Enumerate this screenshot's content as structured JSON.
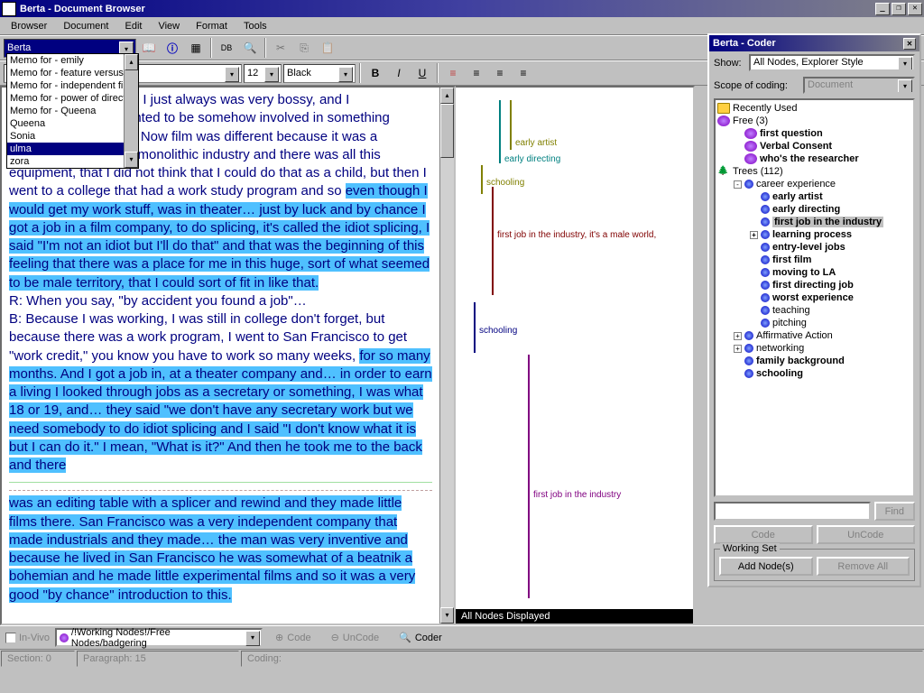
{
  "window": {
    "title": "Berta - Document Browser",
    "min": "_",
    "max": "❐",
    "close": "✕"
  },
  "menu": [
    "Browser",
    "Document",
    "Edit",
    "View",
    "Format",
    "Tools"
  ],
  "toolbar1": {
    "doc_combo": "Berta"
  },
  "dropdown": {
    "items": [
      "Memo for - emily",
      "Memo for - feature versus te",
      "Memo for - independent film",
      "Memo for - power of director",
      "Memo for - Queena",
      "Queena",
      "Sonia",
      "ulma",
      "zora"
    ],
    "selected_index": 7
  },
  "toolbar2": {
    "font": "",
    "size": "12",
    "color": "Black"
  },
  "doc_text": {
    "p1a": "w, I just always was very bossy, and I",
    "p1b": "anted to be somehow involved in something",
    "p1c": "c.  Now film was different because it was a",
    "p1d": "a monolithic industry and there was all this",
    "p1e": "equipment, that I did not think that I could do that as a child, but then I went to a college that had a work study program and so ",
    "p1hl1": "even though I would get my work stuff, was in theater… just by luck and by chance I got a job in a film company, to do splicing, it's called the idiot splicing, I said \"I'm not an idiot but I'll do that\" and that was the beginning of this feeling that there was a place for me in this huge, sort of what seemed to be male territory, that I could sort of fit in like that.",
    "p2": "R:   When you say, \"by accident you found a job\"…",
    "p3a": "B:   Because I was working, I was still in college don't forget, but because there was a work program, I went to San Francisco to get \"work credit,\" you know you have to work so many weeks, ",
    "p3hl": "for so many months.  And I got a job in, at a theater company and…  in order to earn a living I looked through jobs as a secretary or something, I was what 18 or 19, and…  they said \"we don't have any secretary work but we need somebody to do idiot splicing and I said \"I don't know what it is but I can do it.\"  I mean, \"What is it?\"  And then he took me to the back and there",
    "p4hl": "was an editing table with a splicer and rewind and they made little films there.  San Francisco was a very independent company that made industrials and they made…  the man was very inventive and because he lived in San Francisco he was somewhat of a beatnik a bohemian and he made little experimental films and so it was a very good \"by chance\" introduction to this."
  },
  "stripes": {
    "s1": "early artist",
    "s2": "early directing",
    "s3": "schooling",
    "s4": "first job in the industry, it's a male world,",
    "s5": "schooling",
    "s6": "first job in the industry",
    "status": "All Nodes Displayed"
  },
  "coder": {
    "title": "Berta - Coder",
    "show_label": "Show:",
    "show_value": "All Nodes, Explorer Style",
    "scope_label": "Scope of coding:",
    "scope_value": "Document",
    "find": "Find",
    "code": "Code",
    "uncode": "UnCode",
    "working_set": "Working Set",
    "add_nodes": "Add Node(s)",
    "remove_all": "Remove All",
    "tree": {
      "recent": "Recently Used",
      "free": "Free (3)",
      "free1": "first question",
      "free2": "Verbal Consent",
      "free3": "who's the researcher",
      "trees": "Trees (112)",
      "career": "career experience",
      "c1": "early artist",
      "c2": "early directing",
      "c3": "first job in the industry",
      "c4": "learning process",
      "c5": "entry-level jobs",
      "c6": "first film",
      "c7": "moving to LA",
      "c8": "first directing job",
      "c9": "worst experience",
      "c10": "teaching",
      "c11": "pitching",
      "aff": "Affirmative Action",
      "net": "networking",
      "fam": "family background",
      "sch": "schooling"
    }
  },
  "bottom": {
    "invivo": "In-Vivo",
    "path": "/!Working Nodes!/Free Nodes/badgering",
    "code": "Code",
    "uncode": "UnCode",
    "coder": "Coder"
  },
  "status": {
    "section": "Section:  0",
    "para": "Paragraph:  15",
    "coding": "Coding:"
  }
}
